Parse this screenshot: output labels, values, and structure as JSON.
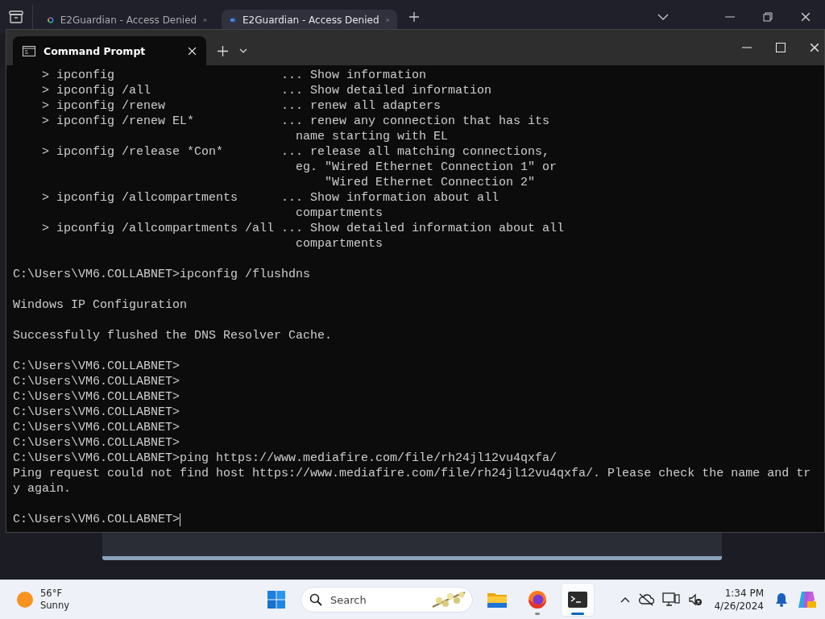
{
  "browser": {
    "tabs": [
      {
        "title": "E2Guardian - Access Denied",
        "selected": false
      },
      {
        "title": "E2Guardian - Access Denied",
        "selected": true
      }
    ]
  },
  "terminal": {
    "tab_title": "Command Prompt",
    "blocks": [
      [
        "    > ipconfig                       ... Show information",
        "    > ipconfig /all                  ... Show detailed information",
        "    > ipconfig /renew                ... renew all adapters",
        "    > ipconfig /renew EL*            ... renew any connection that has its",
        "                                       name starting with EL",
        "    > ipconfig /release *Con*        ... release all matching connections,",
        "                                       eg. \"Wired Ethernet Connection 1\" or",
        "                                           \"Wired Ethernet Connection 2\"",
        "    > ipconfig /allcompartments      ... Show information about all",
        "                                       compartments",
        "    > ipconfig /allcompartments /all ... Show detailed information about all",
        "                                       compartments"
      ],
      [
        "C:\\Users\\VM6.COLLABNET>ipconfig /flushdns"
      ],
      [
        "Windows IP Configuration"
      ],
      [
        "Successfully flushed the DNS Resolver Cache."
      ],
      [
        "C:\\Users\\VM6.COLLABNET>",
        "C:\\Users\\VM6.COLLABNET>",
        "C:\\Users\\VM6.COLLABNET>",
        "C:\\Users\\VM6.COLLABNET>",
        "C:\\Users\\VM6.COLLABNET>",
        "C:\\Users\\VM6.COLLABNET>",
        "C:\\Users\\VM6.COLLABNET>ping https://www.mediafire.com/file/rh24jl12vu4qxfa/",
        "Ping request could not find host https://www.mediafire.com/file/rh24jl12vu4qxfa/. Please check the name and tr",
        "y again."
      ]
    ],
    "input_line": {
      "text": "C:\\Users\\VM6.COLLABNET>",
      "cursor": true
    }
  },
  "taskbar": {
    "weather": {
      "temperature": "56°F",
      "condition": "Sunny"
    },
    "search": {
      "placeholder": "Search"
    },
    "apps": [
      {
        "selected": false,
        "running": false
      },
      {
        "selected": false,
        "running": true
      },
      {
        "selected": true,
        "running": true
      }
    ],
    "clock": {
      "time": "1:34 PM",
      "date": "4/26/2024"
    }
  }
}
